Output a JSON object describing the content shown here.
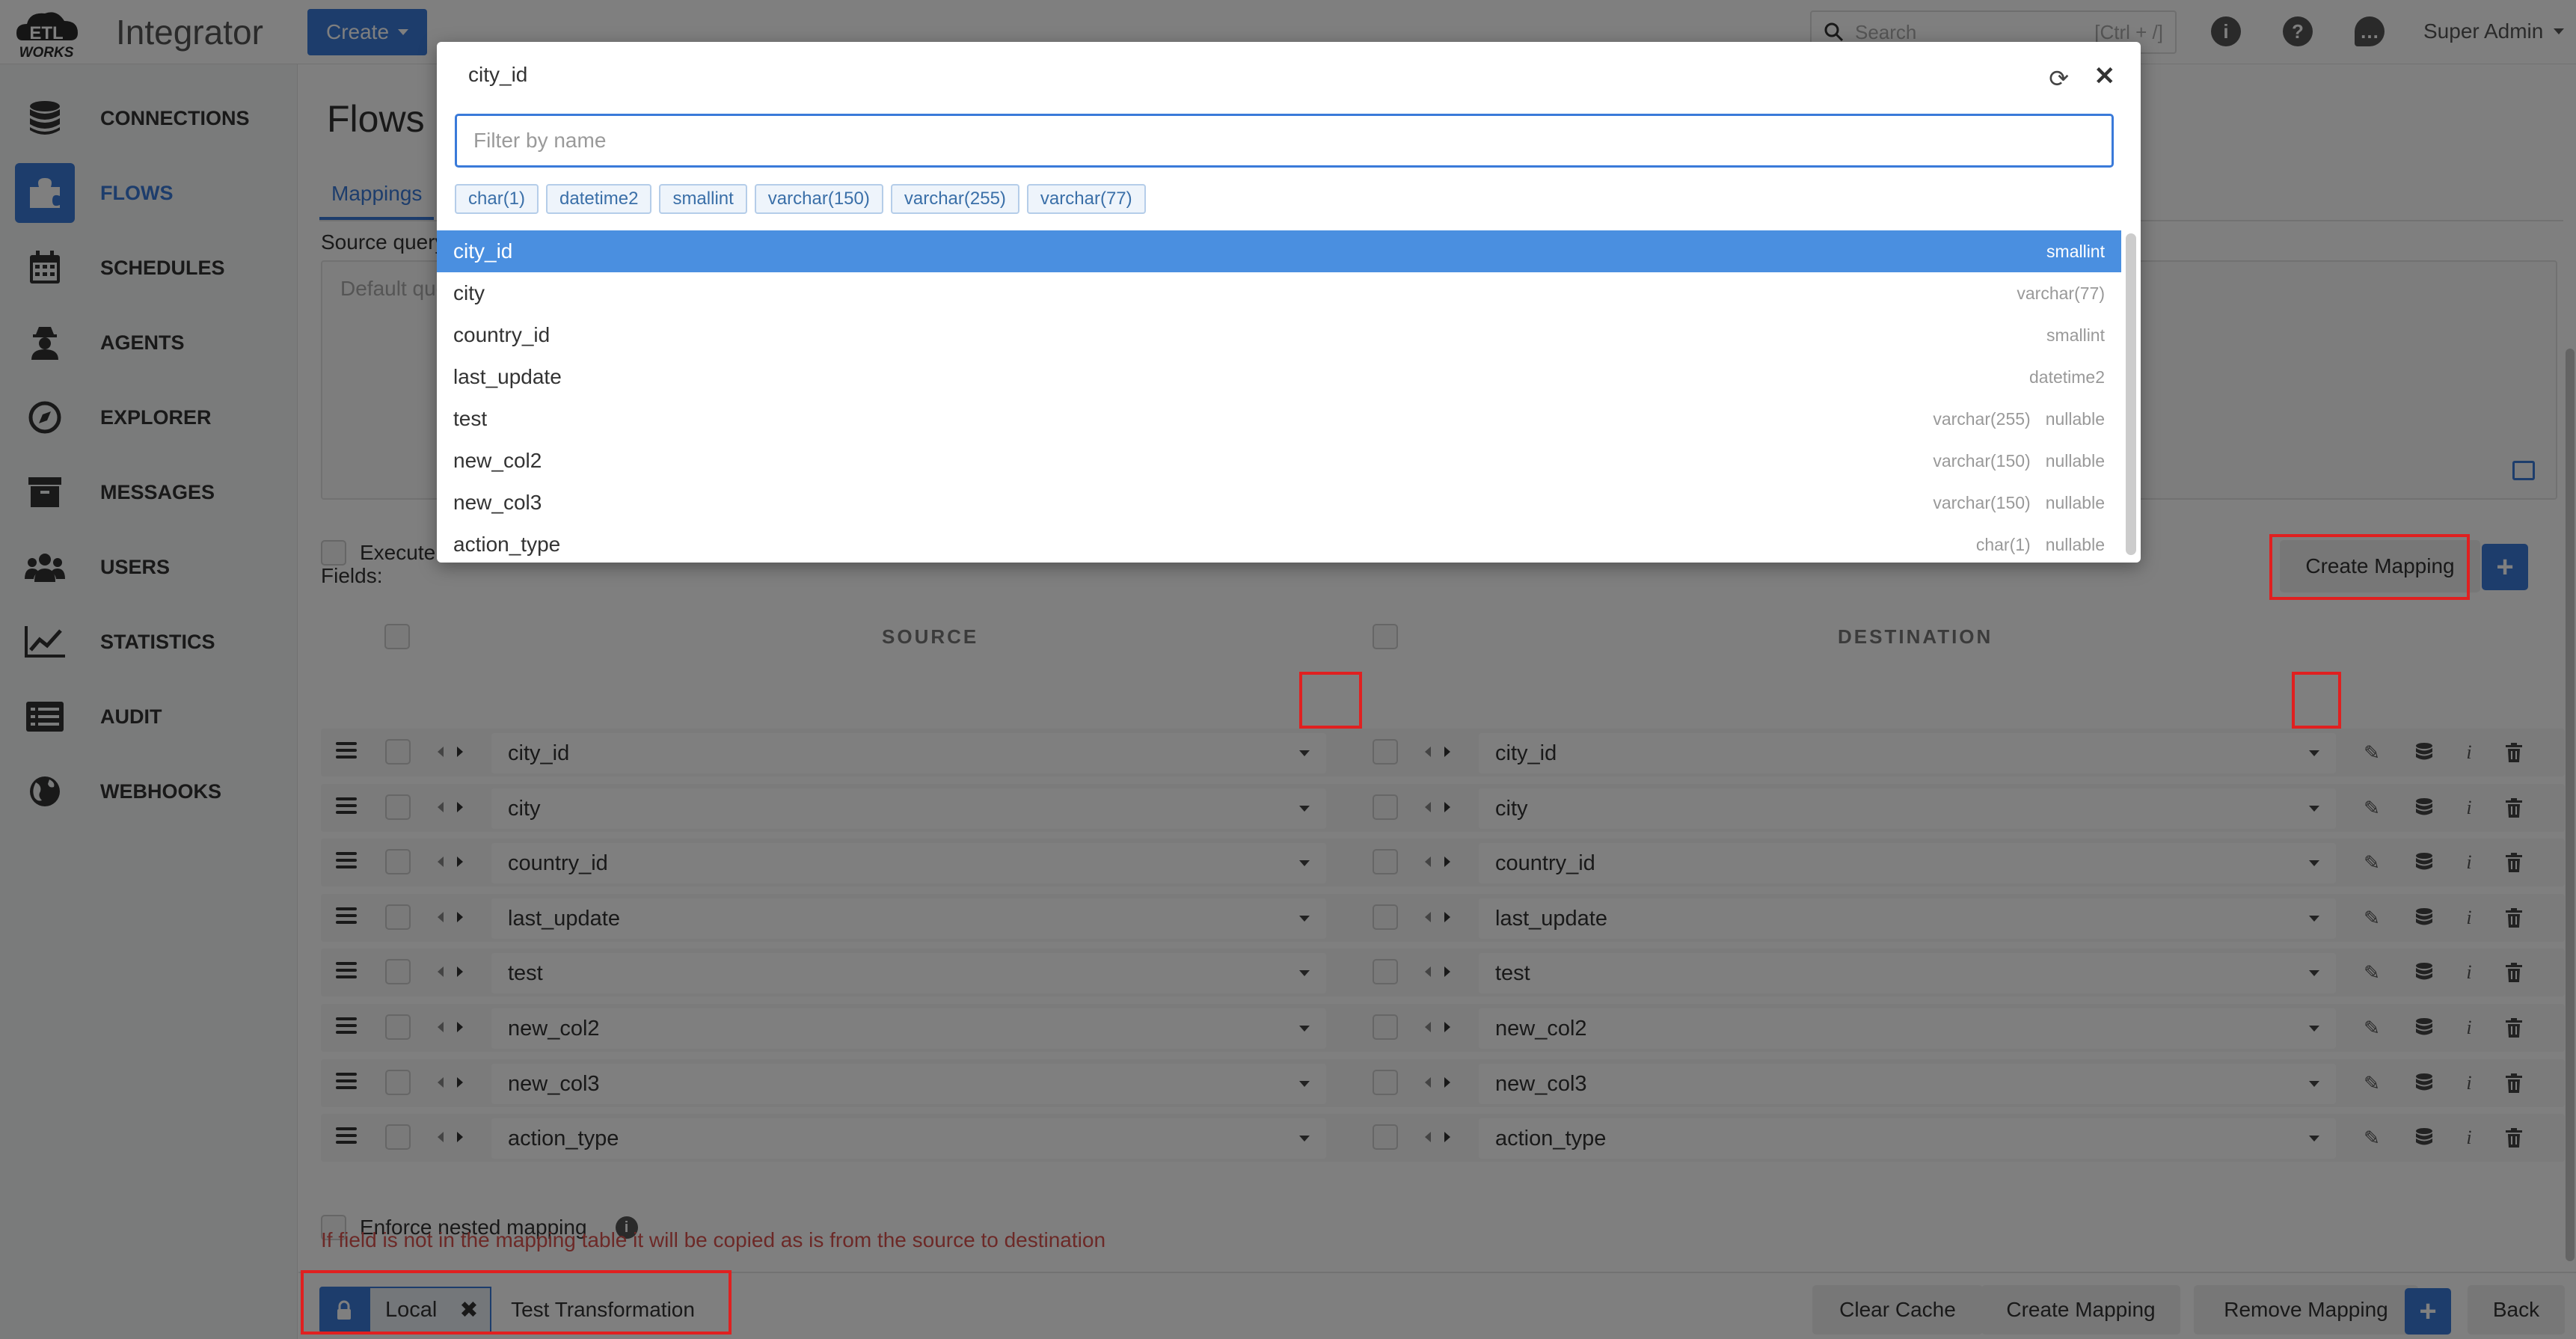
{
  "app": {
    "logo_top": "ETL",
    "logo_bottom": "WORKS",
    "title": "Integrator"
  },
  "topbar": {
    "create_label": "Create",
    "search_placeholder": "Search",
    "search_hint": "[Ctrl + /]",
    "user": "Super Admin"
  },
  "sidebar": {
    "items": [
      {
        "label": "CONNECTIONS",
        "icon": "database-icon"
      },
      {
        "label": "FLOWS",
        "icon": "puzzle-icon",
        "active": true
      },
      {
        "label": "SCHEDULES",
        "icon": "calendar-icon"
      },
      {
        "label": "AGENTS",
        "icon": "user-secret-icon"
      },
      {
        "label": "EXPLORER",
        "icon": "compass-icon"
      },
      {
        "label": "MESSAGES",
        "icon": "archive-icon"
      },
      {
        "label": "USERS",
        "icon": "users-icon"
      },
      {
        "label": "STATISTICS",
        "icon": "chart-line-icon"
      },
      {
        "label": "AUDIT",
        "icon": "list-icon"
      },
      {
        "label": "WEBHOOKS",
        "icon": "globe-icon"
      }
    ]
  },
  "main": {
    "title": "Flows",
    "tab": "Mappings",
    "source_query_label": "Source query",
    "source_query_placeholder": "Default query",
    "execute_label": "Execute",
    "fields_label": "Fields:",
    "create_mapping": "Create Mapping",
    "plus": "+",
    "source_header": "SOURCE",
    "destination_header": "DESTINATION",
    "enforce_label": "Enforce nested mapping",
    "warning": "If field is not in the mapping table it will be copied as is from the source to destination"
  },
  "mapping_rows": [
    {
      "source": "city_id",
      "destination": "city_id"
    },
    {
      "source": "city",
      "destination": "city"
    },
    {
      "source": "country_id",
      "destination": "country_id"
    },
    {
      "source": "last_update",
      "destination": "last_update"
    },
    {
      "source": "test",
      "destination": "test"
    },
    {
      "source": "new_col2",
      "destination": "new_col2"
    },
    {
      "source": "new_col3",
      "destination": "new_col3"
    },
    {
      "source": "action_type",
      "destination": "action_type"
    }
  ],
  "footer": {
    "local": "Local",
    "test_transformation": "Test Transformation",
    "clear_cache": "Clear Cache",
    "create_mapping": "Create Mapping",
    "remove_mapping": "Remove Mapping",
    "plus": "+",
    "back": "Back"
  },
  "modal": {
    "title": "city_id",
    "filter_placeholder": "Filter by name",
    "chips": [
      "char(1)",
      "datetime2",
      "smallint",
      "varchar(150)",
      "varchar(255)",
      "varchar(77)"
    ],
    "items": [
      {
        "name": "city_id",
        "type": "smallint",
        "nullable": "",
        "selected": true
      },
      {
        "name": "city",
        "type": "varchar(77)",
        "nullable": ""
      },
      {
        "name": "country_id",
        "type": "smallint",
        "nullable": ""
      },
      {
        "name": "last_update",
        "type": "datetime2",
        "nullable": ""
      },
      {
        "name": "test",
        "type": "varchar(255)",
        "nullable": "nullable"
      },
      {
        "name": "new_col2",
        "type": "varchar(150)",
        "nullable": "nullable"
      },
      {
        "name": "new_col3",
        "type": "varchar(150)",
        "nullable": "nullable"
      },
      {
        "name": "action_type",
        "type": "char(1)",
        "nullable": "nullable"
      }
    ]
  },
  "colors": {
    "accent": "#3a7ad9",
    "highlight": "#e02020",
    "warning": "#d9534f"
  }
}
